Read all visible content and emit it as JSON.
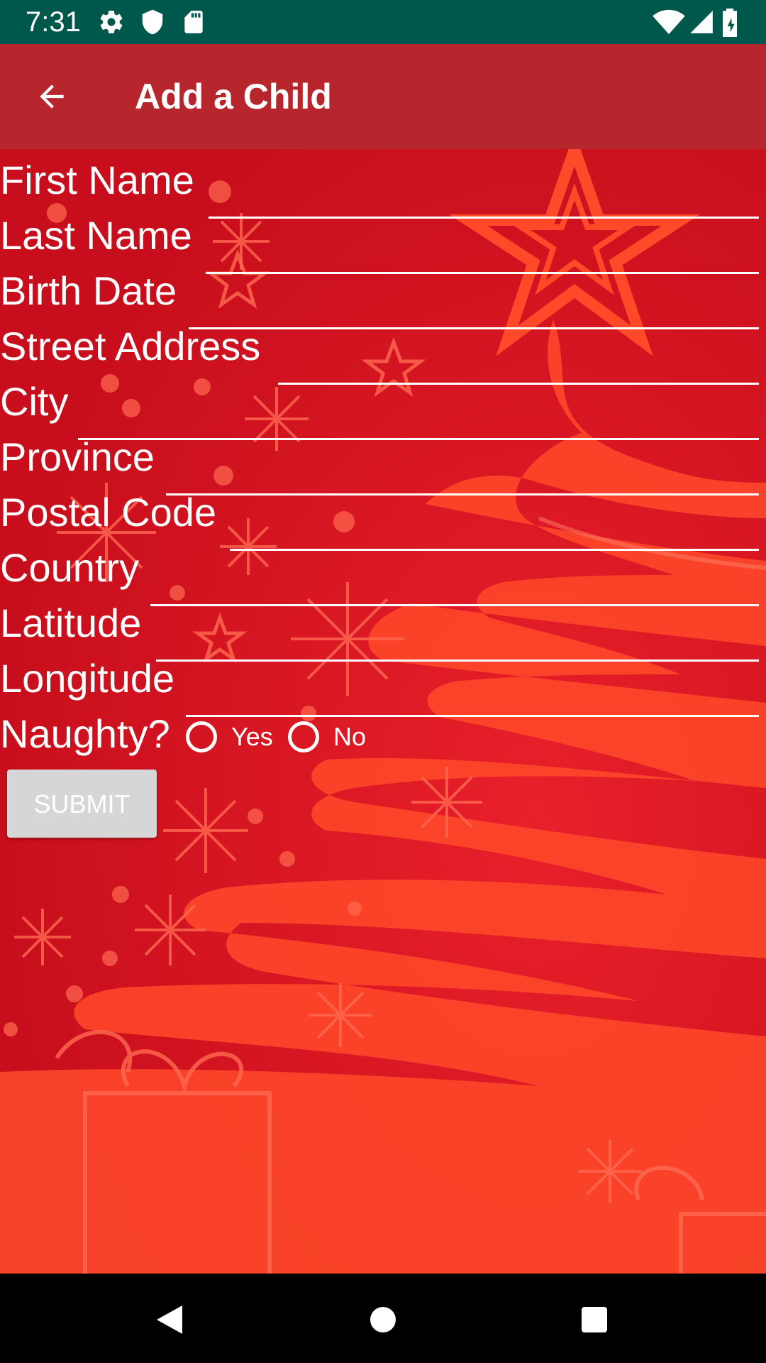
{
  "status_bar": {
    "time": "7:31",
    "left_icons": [
      "gear-icon",
      "shield-icon",
      "sd-card-icon"
    ],
    "right_icons": [
      "wifi-icon",
      "cell-signal-icon",
      "battery-icon"
    ],
    "color": "#00574b"
  },
  "app_bar": {
    "title": "Add a Child",
    "back_icon": "arrow-left-icon",
    "color": "#b7262c"
  },
  "form": {
    "fields": [
      {
        "label": "First Name",
        "value": ""
      },
      {
        "label": "Last Name",
        "value": ""
      },
      {
        "label": "Birth Date",
        "value": ""
      },
      {
        "label": "Street Address",
        "value": ""
      },
      {
        "label": "City",
        "value": ""
      },
      {
        "label": "Province",
        "value": ""
      },
      {
        "label": "Postal Code",
        "value": ""
      },
      {
        "label": "Country",
        "value": ""
      },
      {
        "label": "Latitude",
        "value": ""
      },
      {
        "label": "Longitude",
        "value": ""
      }
    ],
    "naughty": {
      "label": "Naughty?",
      "options": [
        "Yes",
        "No"
      ],
      "selected": null
    },
    "submit_label": "SUBMIT"
  },
  "background": {
    "color": "#d8101e",
    "accent": "#ff4a2a"
  },
  "nav_bar": {
    "icons": [
      "back-triangle-icon",
      "home-circle-icon",
      "recents-square-icon"
    ]
  }
}
